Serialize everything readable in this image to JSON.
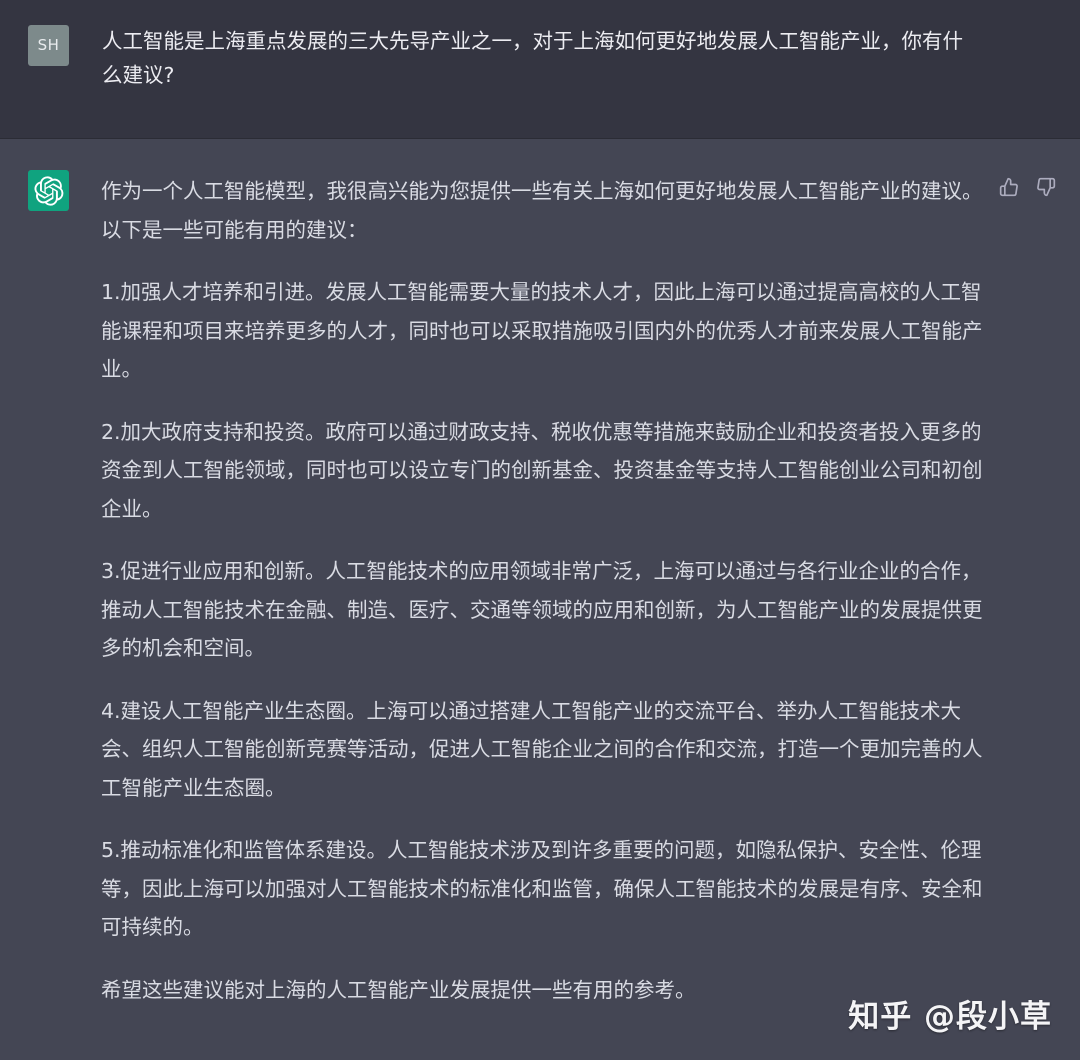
{
  "conversation": {
    "user": {
      "avatar_initials": "SH",
      "message": "人工智能是上海重点发展的三大先导产业之一，对于上海如何更好地发展人工智能产业，你有什么建议?"
    },
    "assistant": {
      "avatar_icon": "openai-logo-icon",
      "paragraphs": [
        "作为一个人工智能模型，我很高兴能为您提供一些有关上海如何更好地发展人工智能产业的建议。以下是一些可能有用的建议：",
        "1.加强人才培养和引进。发展人工智能需要大量的技术人才，因此上海可以通过提高高校的人工智能课程和项目来培养更多的人才，同时也可以采取措施吸引国内外的优秀人才前来发展人工智能产业。",
        "2.加大政府支持和投资。政府可以通过财政支持、税收优惠等措施来鼓励企业和投资者投入更多的资金到人工智能领域，同时也可以设立专门的创新基金、投资基金等支持人工智能创业公司和初创企业。",
        "3.促进行业应用和创新。人工智能技术的应用领域非常广泛，上海可以通过与各行业企业的合作，推动人工智能技术在金融、制造、医疗、交通等领域的应用和创新，为人工智能产业的发展提供更多的机会和空间。",
        "4.建设人工智能产业生态圈。上海可以通过搭建人工智能产业的交流平台、举办人工智能技术大会、组织人工智能创新竞赛等活动，促进人工智能企业之间的合作和交流，打造一个更加完善的人工智能产业生态圈。",
        "5.推动标准化和监管体系建设。人工智能技术涉及到许多重要的问题，如隐私保护、安全性、伦理等，因此上海可以加强对人工智能技术的标准化和监管，确保人工智能技术的发展是有序、安全和可持续的。",
        "希望这些建议能对上海的人工智能产业发展提供一些有用的参考。"
      ],
      "feedback": {
        "like_icon": "thumbs-up-icon",
        "dislike_icon": "thumbs-down-icon"
      }
    }
  },
  "watermark": "知乎 @段小草",
  "colors": {
    "user_bg": "#343541",
    "assistant_bg": "#444654",
    "assistant_avatar": "#10a37f",
    "user_avatar": "#7d8a8b"
  }
}
